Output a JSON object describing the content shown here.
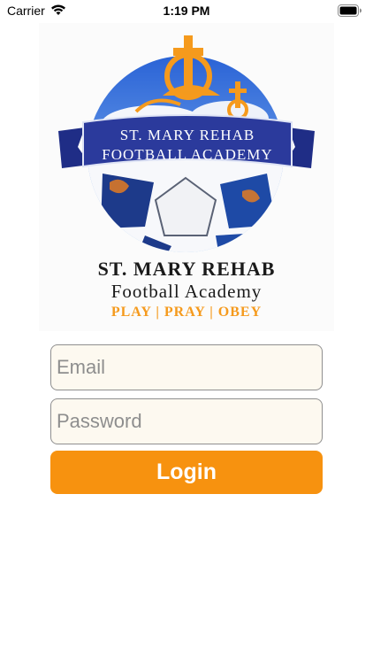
{
  "status_bar": {
    "carrier": "Carrier",
    "time": "1:19 PM",
    "icons": [
      "wifi-icon",
      "battery-icon"
    ]
  },
  "logo": {
    "banner_line1": "ST. MARY REHAB",
    "banner_line2": "FOOTBALL ACADEMY",
    "title": "ST. MARY REHAB",
    "subtitle": "Football Academy",
    "motto": "PLAY | PRAY | OBEY",
    "colors": {
      "banner": "#2b3a9c",
      "accent": "#f59a1d",
      "sky": "#3d7fe0"
    }
  },
  "form": {
    "email_placeholder": "Email",
    "email_value": "",
    "password_placeholder": "Password",
    "password_value": "",
    "login_label": "Login"
  },
  "theme": {
    "button_color": "#f7920f",
    "field_background": "#fdf9f0"
  }
}
